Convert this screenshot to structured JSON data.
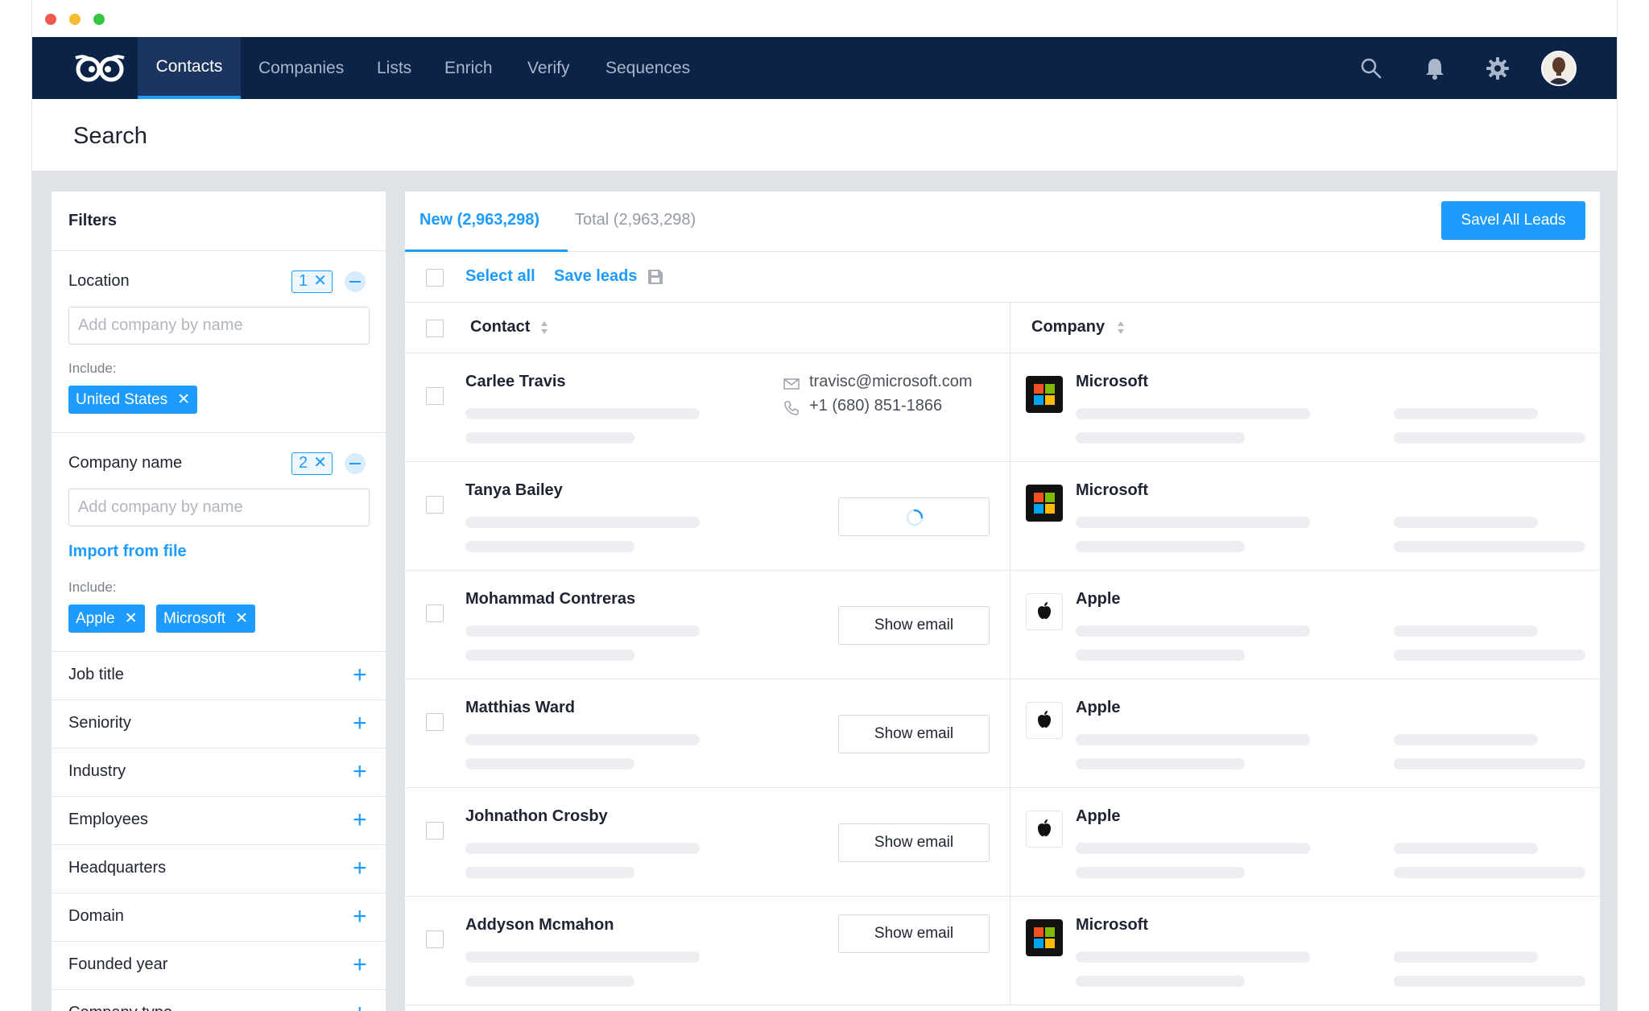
{
  "nav": {
    "items": [
      "Contacts",
      "Companies",
      "Lists",
      "Enrich",
      "Verify",
      "Sequences"
    ],
    "active": "Contacts",
    "icons": [
      "search-icon",
      "bell-icon",
      "gear-icon"
    ]
  },
  "page": {
    "title": "Search"
  },
  "filters": {
    "title": "Filters",
    "location": {
      "label": "Location",
      "count": "1",
      "placeholder": "Add company by name",
      "include_label": "Include:",
      "tags": [
        "United States"
      ]
    },
    "company_name": {
      "label": "Company name",
      "count": "2",
      "placeholder": "Add company by name",
      "import_link": "Import from file",
      "include_label": "Include:",
      "tags": [
        "Apple",
        "Microsoft"
      ]
    },
    "collapsed": [
      "Job title",
      "Seniority",
      "Industry",
      "Employees",
      "Headquarters",
      "Domain",
      "Founded year",
      "Company type"
    ]
  },
  "results": {
    "tabs": [
      "New (2,963,298)",
      "Total (2,963,298)"
    ],
    "active_tab": "New (2,963,298)",
    "save_all_label": "Savel All Leads",
    "select_all": "Select all",
    "save_leads": "Save leads",
    "columns": [
      "Contact",
      "Company"
    ],
    "rows": [
      {
        "name": "Carlee Travis",
        "email": "travisc@microsoft.com",
        "phone": "+1 (680) 851-1866",
        "company": "Microsoft",
        "state": "revealed"
      },
      {
        "name": "Tanya Bailey",
        "company": "Microsoft",
        "state": "loading"
      },
      {
        "name": "Mohammad Contreras",
        "company": "Apple",
        "state": "hidden",
        "button": "Show email"
      },
      {
        "name": "Matthias Ward",
        "company": "Apple",
        "state": "hidden",
        "button": "Show email"
      },
      {
        "name": "Johnathon Crosby",
        "company": "Apple",
        "state": "hidden",
        "button": "Show email"
      },
      {
        "name": "Addyson Mcmahon",
        "company": "Microsoft",
        "state": "hidden",
        "button": "Show email"
      }
    ]
  },
  "colors": {
    "navy": "#0c2348",
    "accent": "#1e9bff",
    "panel_bg": "#dfe2e7"
  }
}
